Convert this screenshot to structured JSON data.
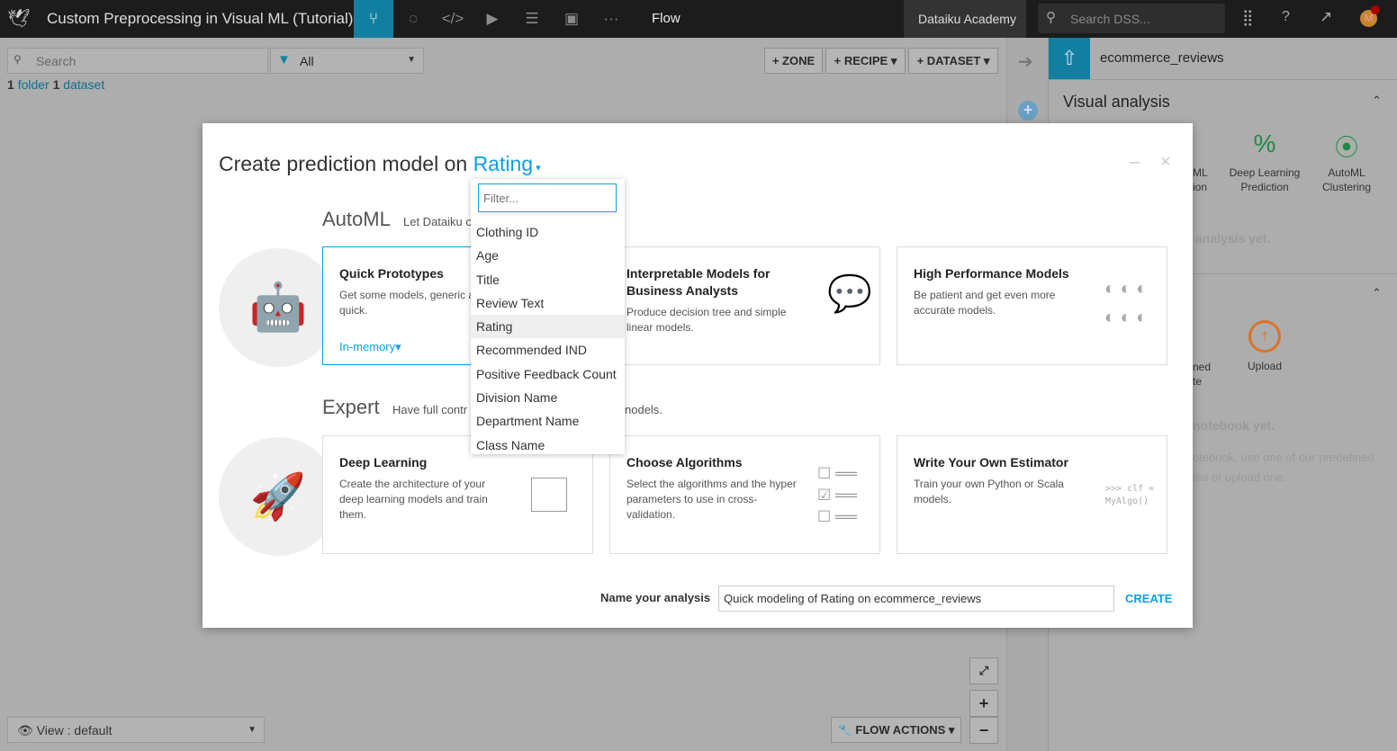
{
  "topbar": {
    "project_title": "Custom Preprocessing in Visual ML (Tutorial)",
    "current_view": "Flow",
    "instance": "Dataiku Academy",
    "search_placeholder": "Search DSS...",
    "avatar_initial": "M"
  },
  "flow": {
    "search_placeholder": "Search",
    "filter_value": "All",
    "summary": {
      "folder_count": "1",
      "folder_label": "folder",
      "dataset_count": "1",
      "dataset_label": "dataset"
    },
    "buttons": {
      "zone": "+ ZONE",
      "recipe": "+ RECIPE",
      "dataset": "+ DATASET",
      "flow_actions": "FLOW ACTIONS"
    },
    "view_label": "View : default"
  },
  "right_panel": {
    "dataset_name": "ecommerce_reviews",
    "visual_analysis": "Visual analysis",
    "items": [
      {
        "label": "ML\nion"
      },
      {
        "label": "Deep Learning Prediction"
      },
      {
        "label": "AutoML Clustering"
      }
    ],
    "no_analysis": "analysis yet.",
    "notebook_items": [
      {
        "label": "ned\nte"
      },
      {
        "label": "Upload"
      }
    ],
    "no_notebook": "notebook yet.",
    "notebook_hint": "otebook, use one of our predefined\ntes or upload one."
  },
  "modal": {
    "title_prefix": "Create prediction model on",
    "target": "Rating",
    "automl": {
      "heading": "AutoML",
      "subtitle": "Let Dataiku c"
    },
    "expert": {
      "heading": "Expert",
      "subtitle": "Have full contr",
      "subtitle_tail": "nodels."
    },
    "cards": [
      {
        "title": "Quick Prototypes",
        "desc": "Get some models, generic a\nquick.",
        "engine": "In-memory"
      },
      {
        "title": "Interpretable Models for Business Analysts",
        "desc": "Produce decision tree and simple linear models."
      },
      {
        "title": "High Performance Models",
        "desc": "Be patient and get even more accurate models."
      },
      {
        "title": "Deep Learning",
        "desc": "Create the architecture of your deep learning models and train them."
      },
      {
        "title": "Choose Algorithms",
        "desc": "Select the algorithms and the hyper parameters to use in cross-validation."
      },
      {
        "title": "Write Your Own Estimator",
        "desc": "Train your own Python or Scala models.",
        "code": ">>> clf =\nMyAlgo()"
      }
    ],
    "name_label": "Name your analysis",
    "name_value": "Quick modeling of Rating on ecommerce_reviews",
    "create": "CREATE"
  },
  "dropdown": {
    "filter_placeholder": "Filter...",
    "selected": "Rating",
    "options": [
      "Clothing ID",
      "Age",
      "Title",
      "Review Text",
      "Rating",
      "Recommended IND",
      "Positive Feedback Count",
      "Division Name",
      "Department Name",
      "Class Name"
    ]
  },
  "colors": {
    "accent": "#0aa0e6",
    "flow_active": "#137fa0",
    "green": "#1e8a45",
    "orange": "#d9742b"
  }
}
